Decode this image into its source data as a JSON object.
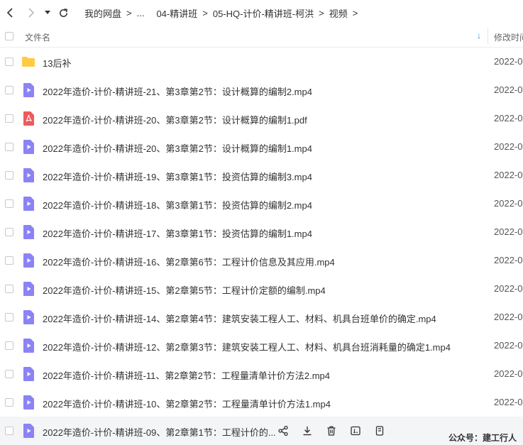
{
  "breadcrumb": {
    "items": [
      "我的网盘",
      "...",
      "04-精讲班",
      "05-HQ-计价-精讲班-柯洪",
      "视频"
    ],
    "separator": ">"
  },
  "header": {
    "name_col": "文件名",
    "modified_col": "修改时间",
    "sort_indicator": "↓"
  },
  "files": [
    {
      "type": "folder",
      "name": "13后补",
      "date": "2022-0"
    },
    {
      "type": "video",
      "name": "2022年造价-计价-精讲班-21、第3章第2节：设计概算的编制2.mp4",
      "date": "2022-0"
    },
    {
      "type": "pdf",
      "name": "2022年造价-计价-精讲班-20、第3章第2节：设计概算的编制1.pdf",
      "date": "2022-0"
    },
    {
      "type": "video",
      "name": "2022年造价-计价-精讲班-20、第3章第2节：设计概算的编制1.mp4",
      "date": "2022-0"
    },
    {
      "type": "video",
      "name": "2022年造价-计价-精讲班-19、第3章第1节：投资估算的编制3.mp4",
      "date": "2022-0"
    },
    {
      "type": "video",
      "name": "2022年造价-计价-精讲班-18、第3章第1节：投资估算的编制2.mp4",
      "date": "2022-0"
    },
    {
      "type": "video",
      "name": "2022年造价-计价-精讲班-17、第3章第1节：投资估算的编制1.mp4",
      "date": "2022-0"
    },
    {
      "type": "video",
      "name": "2022年造价-计价-精讲班-16、第2章第6节：工程计价信息及其应用.mp4",
      "date": "2022-0"
    },
    {
      "type": "video",
      "name": "2022年造价-计价-精讲班-15、第2章第5节：工程计价定额的编制.mp4",
      "date": "2022-0"
    },
    {
      "type": "video",
      "name": "2022年造价-计价-精讲班-14、第2章第4节：建筑安装工程人工、材料、机具台班单价的确定.mp4",
      "date": "2022-0"
    },
    {
      "type": "video",
      "name": "2022年造价-计价-精讲班-12、第2章第3节：建筑安装工程人工、材料、机具台班消耗量的确定1.mp4",
      "date": "2022-0"
    },
    {
      "type": "video",
      "name": "2022年造价-计价-精讲班-11、第2章第2节：工程量清单计价方法2.mp4",
      "date": "2022-0"
    },
    {
      "type": "video",
      "name": "2022年造价-计价-精讲班-10、第2章第2节：工程量清单计价方法1.mp4",
      "date": "2022-0"
    },
    {
      "type": "video",
      "name": "2022年造价-计价-精讲班-09、第2章第1节：工程计价的...",
      "date": ""
    }
  ],
  "watermark": "公众号：建工行人",
  "colors": {
    "folder": "#ffcb45",
    "video": "#8b83f5",
    "pdf": "#ef5a5a",
    "sort_arrow": "#1890ff"
  }
}
